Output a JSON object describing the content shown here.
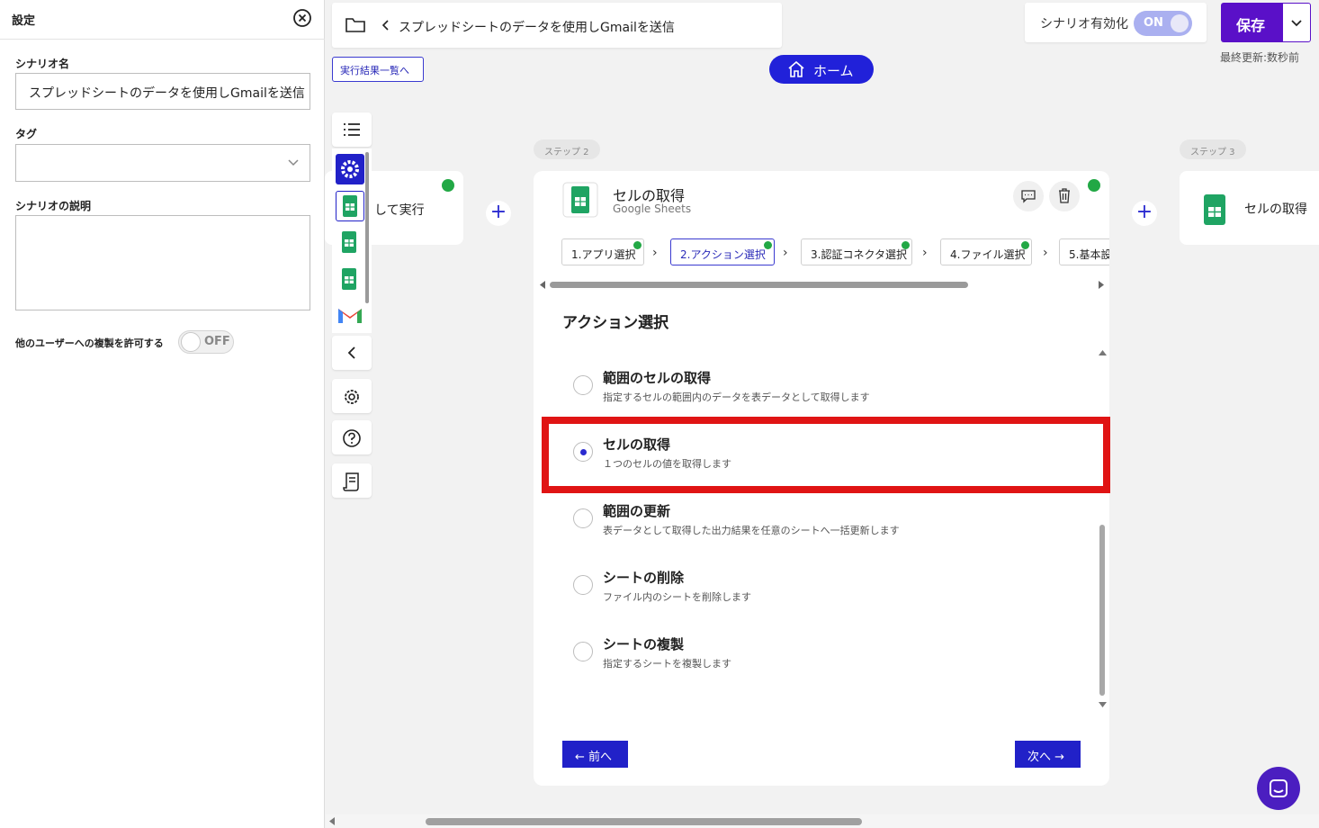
{
  "settings": {
    "title": "設定",
    "scenario_name_label": "シナリオ名",
    "scenario_name_value": "スプレッドシートのデータを使用しGmailを送信",
    "tag_label": "タグ",
    "description_label": "シナリオの説明",
    "allow_copy_label": "他のユーザーへの複製を許可する",
    "allow_copy_state": "OFF"
  },
  "header": {
    "scenario_title": "スプレッドシートのデータを使用しGmailを送信",
    "results_link": "実行結果一覧へ",
    "home_label": "ホーム",
    "enable_label": "シナリオ有効化",
    "enable_state": "ON",
    "save_label": "保存",
    "last_updated": "最終更新:数秒前"
  },
  "steps": {
    "left_card_text": "して実行",
    "step2_pill": "ステップ 2",
    "step3_pill": "ステップ 3",
    "right_card_text": "セルの取得"
  },
  "main_card": {
    "title": "セルの取得",
    "subtitle": "Google Sheets",
    "tabs": [
      {
        "label": "1.アプリ選択"
      },
      {
        "label": "2.アクション選択"
      },
      {
        "label": "3.認証コネクタ選択"
      },
      {
        "label": "4.ファイル選択"
      },
      {
        "label": "5.基本設"
      }
    ],
    "section_title": "アクション選択",
    "options": [
      {
        "title": "範囲のセルの取得",
        "desc": "指定するセルの範囲内のデータを表データとして取得します",
        "selected": false
      },
      {
        "title": "セルの取得",
        "desc": "１つのセルの値を取得します",
        "selected": true
      },
      {
        "title": "範囲の更新",
        "desc": "表データとして取得した出力結果を任意のシートへ一括更新します",
        "selected": false
      },
      {
        "title": "シートの削除",
        "desc": "ファイル内のシートを削除します",
        "selected": false
      },
      {
        "title": "シートの複製",
        "desc": "指定するシートを複製します",
        "selected": false
      }
    ],
    "prev_label": "← 前へ",
    "next_label": "次へ →"
  },
  "colors": {
    "accent": "#2121d9",
    "save": "#5a10c8",
    "highlight": "#e01414",
    "check": "#22a845"
  }
}
